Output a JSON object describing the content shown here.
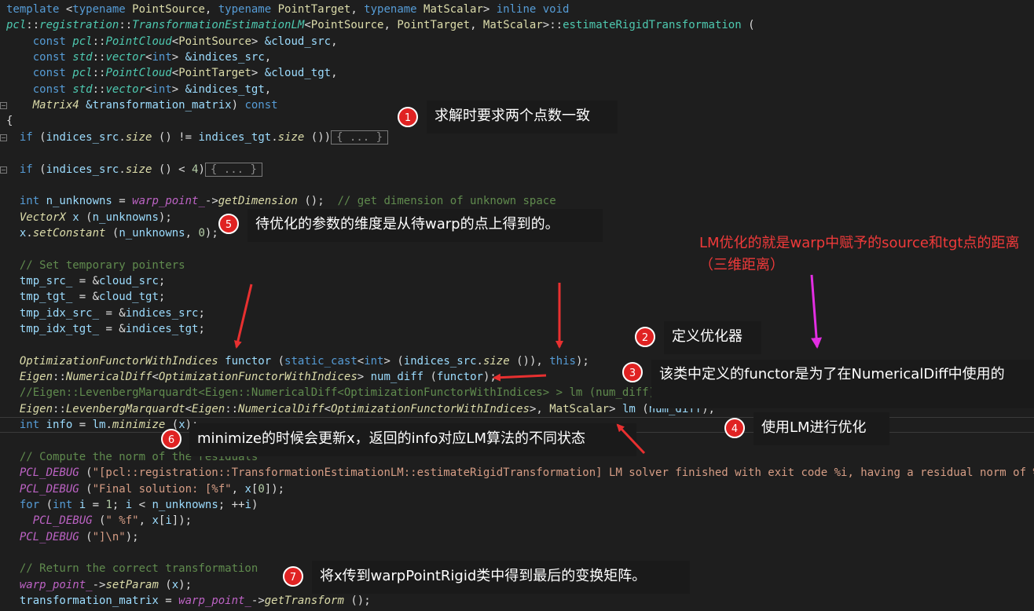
{
  "code_lines": [
    [
      [
        "k",
        "template "
      ],
      [
        "p",
        "<"
      ],
      [
        "k",
        "typename "
      ],
      [
        "tg",
        "PointSource"
      ],
      [
        "p",
        ", "
      ],
      [
        "k",
        "typename "
      ],
      [
        "tg",
        "PointTarget"
      ],
      [
        "p",
        ", "
      ],
      [
        "k",
        "typename "
      ],
      [
        "tg",
        "MatScalar"
      ],
      [
        "p",
        "> "
      ],
      [
        "k",
        "inline void"
      ]
    ],
    [
      [
        "ti",
        "pcl"
      ],
      [
        "p",
        "::"
      ],
      [
        "ti",
        "registration"
      ],
      [
        "p",
        "::"
      ],
      [
        "ti",
        "TransformationEstimationLM"
      ],
      [
        "p",
        "<"
      ],
      [
        "tg",
        "PointSource"
      ],
      [
        "p",
        ", "
      ],
      [
        "tg",
        "PointTarget"
      ],
      [
        "p",
        ", "
      ],
      [
        "tg",
        "MatScalar"
      ],
      [
        "p",
        ">::"
      ],
      [
        "t",
        "estimateRigidTransformation"
      ],
      [
        "p",
        " ("
      ]
    ],
    [
      [
        "k",
        "    const "
      ],
      [
        "ti",
        "pcl"
      ],
      [
        "p",
        "::"
      ],
      [
        "ti",
        "PointCloud"
      ],
      [
        "p",
        "<"
      ],
      [
        "tg",
        "PointSource"
      ],
      [
        "p",
        "> "
      ],
      [
        "v",
        "&cloud_src"
      ],
      [
        "p",
        ","
      ]
    ],
    [
      [
        "k",
        "    const "
      ],
      [
        "ti",
        "std"
      ],
      [
        "p",
        "::"
      ],
      [
        "ti",
        "vector"
      ],
      [
        "p",
        "<"
      ],
      [
        "k",
        "int"
      ],
      [
        "p",
        "> "
      ],
      [
        "v",
        "&indices_src"
      ],
      [
        "p",
        ","
      ]
    ],
    [
      [
        "k",
        "    const "
      ],
      [
        "ti",
        "pcl"
      ],
      [
        "p",
        "::"
      ],
      [
        "ti",
        "PointCloud"
      ],
      [
        "p",
        "<"
      ],
      [
        "tg",
        "PointTarget"
      ],
      [
        "p",
        "> "
      ],
      [
        "v",
        "&cloud_tgt"
      ],
      [
        "p",
        ","
      ]
    ],
    [
      [
        "k",
        "    const "
      ],
      [
        "ti",
        "std"
      ],
      [
        "p",
        "::"
      ],
      [
        "ti",
        "vector"
      ],
      [
        "p",
        "<"
      ],
      [
        "k",
        "int"
      ],
      [
        "p",
        "> "
      ],
      [
        "v",
        "&indices_tgt"
      ],
      [
        "p",
        ","
      ]
    ],
    [
      [
        "m",
        "    Matrix4 "
      ],
      [
        "v",
        "&transformation_matrix"
      ],
      [
        "p",
        ") "
      ],
      [
        "k",
        "const"
      ]
    ],
    [
      [
        "p",
        "{"
      ]
    ],
    [
      [
        "k",
        "  if "
      ],
      [
        "p",
        "("
      ],
      [
        "v",
        "indices_src"
      ],
      [
        "p",
        "."
      ],
      [
        "m",
        "size"
      ],
      [
        "p",
        " () != "
      ],
      [
        "v",
        "indices_tgt"
      ],
      [
        "p",
        "."
      ],
      [
        "m",
        "size"
      ],
      [
        "p",
        " ())"
      ],
      [
        "box",
        "{ ... }"
      ]
    ],
    [],
    [
      [
        "k",
        "  if "
      ],
      [
        "p",
        "("
      ],
      [
        "v",
        "indices_src"
      ],
      [
        "p",
        "."
      ],
      [
        "m",
        "size"
      ],
      [
        "p",
        " () < "
      ],
      [
        "n",
        "4"
      ],
      [
        "p",
        ")"
      ],
      [
        "box",
        "{ ... }"
      ]
    ],
    [],
    [
      [
        "k",
        "  int "
      ],
      [
        "v",
        "n_unknowns"
      ],
      [
        "p",
        " = "
      ],
      [
        "mac",
        "warp_point_"
      ],
      [
        "p",
        "->"
      ],
      [
        "m",
        "getDimension"
      ],
      [
        "p",
        " ();  "
      ],
      [
        "c",
        "// get dimension of unknown space"
      ]
    ],
    [
      [
        "m",
        "  VectorX "
      ],
      [
        "v",
        "x"
      ],
      [
        "p",
        " ("
      ],
      [
        "v",
        "n_unknowns"
      ],
      [
        "p",
        ");"
      ]
    ],
    [
      [
        "v",
        "  x"
      ],
      [
        "p",
        "."
      ],
      [
        "m",
        "setConstant"
      ],
      [
        "p",
        " ("
      ],
      [
        "v",
        "n_unknowns"
      ],
      [
        "p",
        ", "
      ],
      [
        "n",
        "0"
      ],
      [
        "p",
        ");"
      ]
    ],
    [],
    [
      [
        "c",
        "  // Set temporary pointers"
      ]
    ],
    [
      [
        "v",
        "  tmp_src_"
      ],
      [
        "p",
        " = &"
      ],
      [
        "v",
        "cloud_src"
      ],
      [
        "p",
        ";"
      ]
    ],
    [
      [
        "v",
        "  tmp_tgt_"
      ],
      [
        "p",
        " = &"
      ],
      [
        "v",
        "cloud_tgt"
      ],
      [
        "p",
        ";"
      ]
    ],
    [
      [
        "v",
        "  tmp_idx_src_"
      ],
      [
        "p",
        " = &"
      ],
      [
        "v",
        "indices_src"
      ],
      [
        "p",
        ";"
      ]
    ],
    [
      [
        "v",
        "  tmp_idx_tgt_"
      ],
      [
        "p",
        " = &"
      ],
      [
        "v",
        "indices_tgt"
      ],
      [
        "p",
        ";"
      ]
    ],
    [],
    [
      [
        "m",
        "  OptimizationFunctorWithIndices "
      ],
      [
        "v",
        "functor"
      ],
      [
        "p",
        " ("
      ],
      [
        "k",
        "static_cast"
      ],
      [
        "p",
        "<"
      ],
      [
        "k",
        "int"
      ],
      [
        "p",
        "> ("
      ],
      [
        "v",
        "indices_src"
      ],
      [
        "p",
        "."
      ],
      [
        "m",
        "size"
      ],
      [
        "p",
        " ()), "
      ],
      [
        "k",
        "this"
      ],
      [
        "p",
        ");"
      ]
    ],
    [
      [
        "m",
        "  Eigen"
      ],
      [
        "p",
        "::"
      ],
      [
        "m",
        "NumericalDiff"
      ],
      [
        "p",
        "<"
      ],
      [
        "m",
        "OptimizationFunctorWithIndices"
      ],
      [
        "p",
        "> "
      ],
      [
        "v",
        "num_diff"
      ],
      [
        "p",
        " ("
      ],
      [
        "v",
        "functor"
      ],
      [
        "p",
        ");"
      ]
    ],
    [
      [
        "c",
        "  //Eigen::LevenbergMarquardt<Eigen::NumericalDiff<OptimizationFunctorWithIndices> > lm (num_diff);"
      ]
    ],
    [
      [
        "m",
        "  Eigen"
      ],
      [
        "p",
        "::"
      ],
      [
        "m",
        "LevenbergMarquardt"
      ],
      [
        "p",
        "<"
      ],
      [
        "m",
        "Eigen"
      ],
      [
        "p",
        "::"
      ],
      [
        "m",
        "NumericalDiff"
      ],
      [
        "p",
        "<"
      ],
      [
        "m",
        "OptimizationFunctorWithIndices"
      ],
      [
        "p",
        ">, "
      ],
      [
        "tg",
        "MatScalar"
      ],
      [
        "p",
        "> "
      ],
      [
        "v",
        "lm"
      ],
      [
        "p",
        " ("
      ],
      [
        "v",
        "num_diff"
      ],
      [
        "p",
        ");"
      ]
    ],
    [
      [
        "k",
        "  int "
      ],
      [
        "v",
        "info"
      ],
      [
        "p",
        " = "
      ],
      [
        "v",
        "lm"
      ],
      [
        "p",
        "."
      ],
      [
        "m",
        "minimize"
      ],
      [
        "p",
        " ("
      ],
      [
        "v",
        "x"
      ],
      [
        "p",
        ");"
      ]
    ],
    [],
    [
      [
        "c",
        "  // Compute the norm of the residuals"
      ]
    ],
    [
      [
        "mac",
        "  PCL_DEBUG"
      ],
      [
        "p",
        " ("
      ],
      [
        "s",
        "\"[pcl::registration::TransformationEstimationLM::estimateRigidTransformation] LM solver finished with exit code %i, having a residual norm of %g."
      ]
    ],
    [
      [
        "mac",
        "  PCL_DEBUG"
      ],
      [
        "p",
        " ("
      ],
      [
        "s",
        "\"Final solution: [%f\""
      ],
      [
        "p",
        ", "
      ],
      [
        "v",
        "x"
      ],
      [
        "p",
        "["
      ],
      [
        "n",
        "0"
      ],
      [
        "p",
        "]);"
      ]
    ],
    [
      [
        "k",
        "  for "
      ],
      [
        "p",
        "("
      ],
      [
        "k",
        "int "
      ],
      [
        "v",
        "i"
      ],
      [
        "p",
        " = "
      ],
      [
        "n",
        "1"
      ],
      [
        "p",
        "; "
      ],
      [
        "v",
        "i"
      ],
      [
        "p",
        " < "
      ],
      [
        "v",
        "n_unknowns"
      ],
      [
        "p",
        "; ++"
      ],
      [
        "v",
        "i"
      ],
      [
        "p",
        ")"
      ]
    ],
    [
      [
        "mac",
        "    PCL_DEBUG"
      ],
      [
        "p",
        " ("
      ],
      [
        "s",
        "\" %f\""
      ],
      [
        "p",
        ", "
      ],
      [
        "v",
        "x"
      ],
      [
        "p",
        "["
      ],
      [
        "v",
        "i"
      ],
      [
        "p",
        "]);"
      ]
    ],
    [
      [
        "mac",
        "  PCL_DEBUG"
      ],
      [
        "p",
        " ("
      ],
      [
        "s",
        "\"]\\n\""
      ],
      [
        "p",
        ");"
      ]
    ],
    [],
    [
      [
        "c",
        "  // Return the correct transformation"
      ]
    ],
    [
      [
        "mac",
        "  warp_point_"
      ],
      [
        "p",
        "->"
      ],
      [
        "m",
        "setParam"
      ],
      [
        "p",
        " ("
      ],
      [
        "v",
        "x"
      ],
      [
        "p",
        ");"
      ]
    ],
    [
      [
        "v",
        "  transformation_matrix"
      ],
      [
        "p",
        " = "
      ],
      [
        "mac",
        "warp_point_"
      ],
      [
        "p",
        "->"
      ],
      [
        "m",
        "getTransform"
      ],
      [
        "p",
        " ();"
      ]
    ]
  ],
  "badges": [
    "1",
    "2",
    "3",
    "4",
    "5",
    "6",
    "7"
  ],
  "notes": {
    "n1": "求解时要求两个点数一致",
    "n2": "定义优化器",
    "n3": "该类中定义的functor是为了在NumericalDiff中使用的",
    "n4": "使用LM进行优化",
    "n5": "待优化的参数的维度是从待warp的点上得到的。",
    "n6": "minimize的时候会更新x，返回的info对应LM算法的不同状态",
    "n7": "将x传到warpPointRigid类中得到最后的变换矩阵。"
  },
  "red_note": "LM优化的就是warp中赋予的source和tgt点的距离（三维距离）",
  "colors": {
    "background": "#1e1e1e",
    "badge": "#e02222",
    "red_arrow": "#e83030",
    "magenta_arrow": "#e22ee2"
  }
}
